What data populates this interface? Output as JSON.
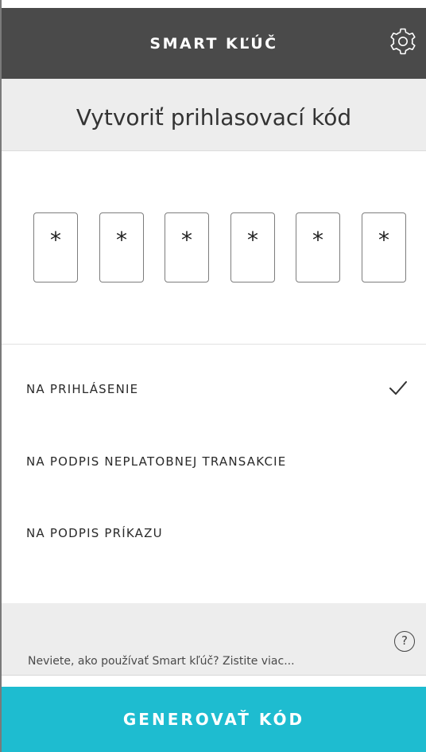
{
  "header": {
    "title": "SMART KĽÚČ",
    "settings_icon": "gear-icon"
  },
  "subheader": {
    "title": "Vytvoriť prihlasovací kód"
  },
  "pin": {
    "digits": [
      "*",
      "*",
      "*",
      "*",
      "*",
      "*"
    ]
  },
  "options": [
    {
      "label": "NA PRIHLÁSENIE",
      "selected": true
    },
    {
      "label": "NA PODPIS NEPLATOBNEJ TRANSAKCIE",
      "selected": false
    },
    {
      "label": "NA PODPIS PRÍKAZU",
      "selected": false
    }
  ],
  "help": {
    "text": "Neviete, ako používať Smart kľúč? Zistite viac...",
    "icon_label": "?"
  },
  "footer": {
    "generate_label": "GENEROVAŤ KÓD"
  },
  "colors": {
    "header_bg": "#4a4a4a",
    "accent": "#1ebcd0",
    "panel_bg": "#ededed"
  }
}
